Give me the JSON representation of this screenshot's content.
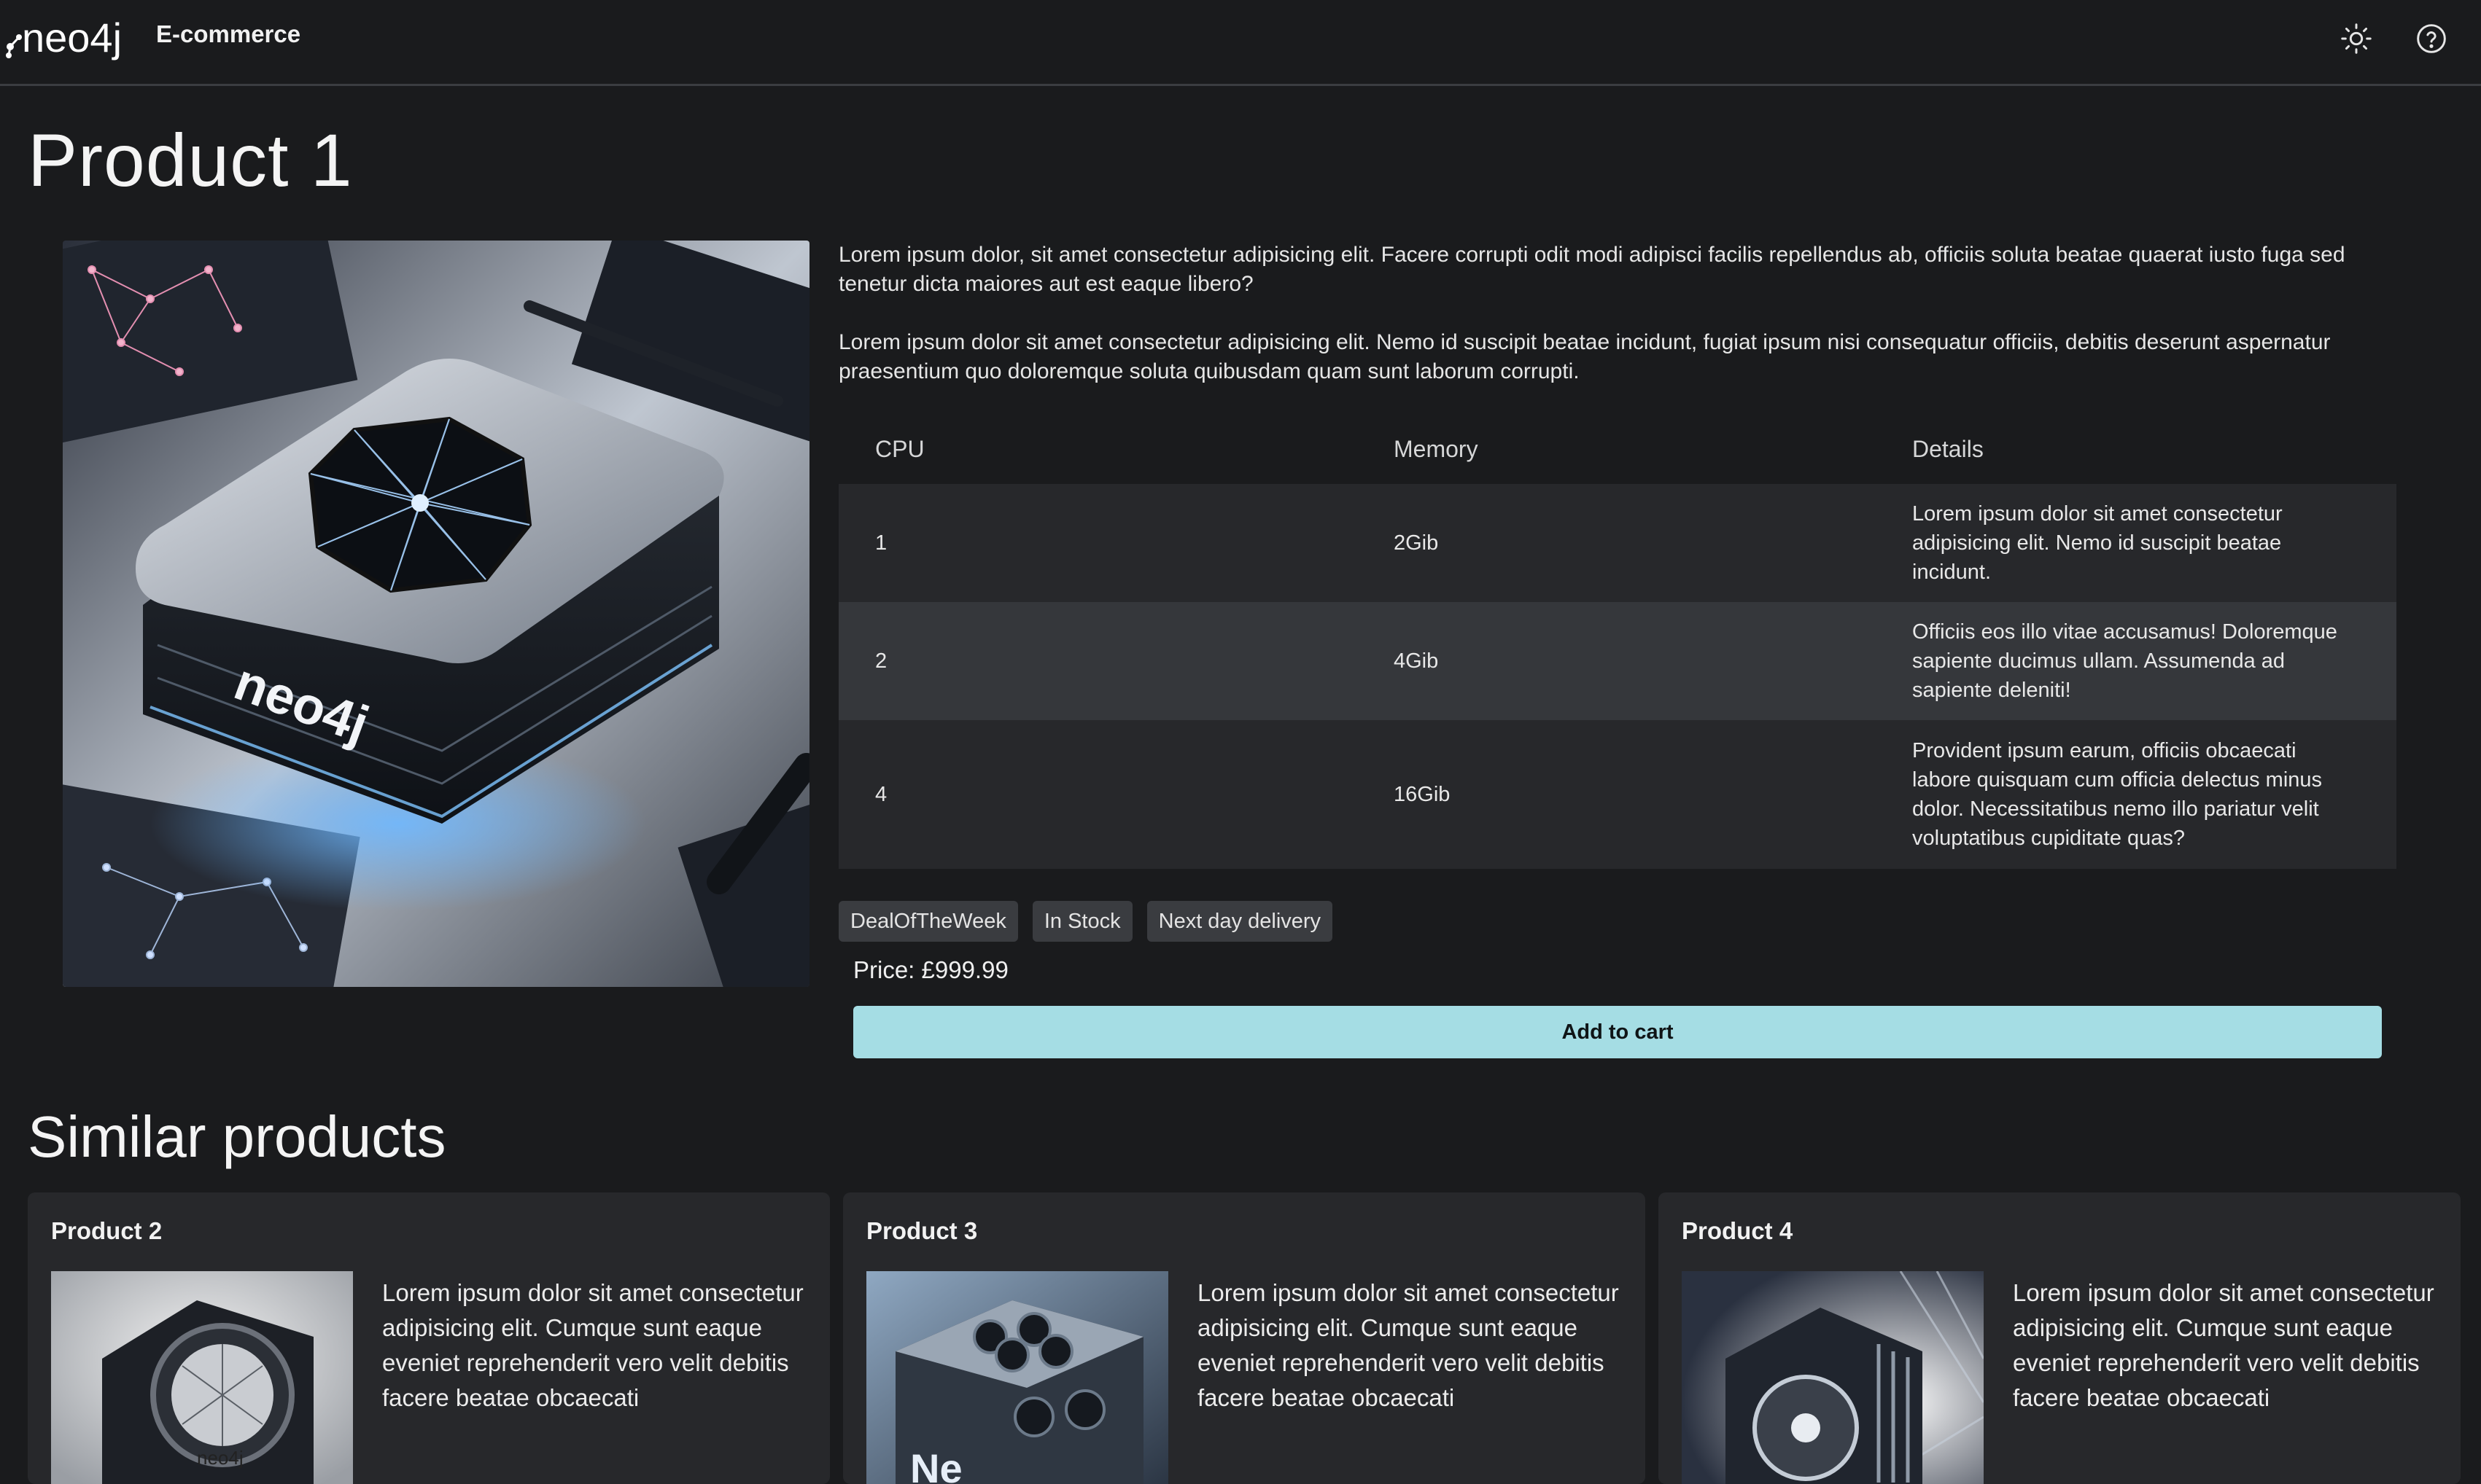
{
  "header": {
    "logo_text": "neo4j",
    "app_name": "E-commerce"
  },
  "product": {
    "title": "Product 1",
    "image_alt": "neo4j",
    "description": [
      "Lorem ipsum dolor, sit amet consectetur adipisicing elit. Facere corrupti odit modi adipisci facilis repellendus ab, officiis soluta beatae quaerat iusto fuga sed tenetur dicta maiores aut est eaque libero?",
      "Lorem ipsum dolor sit amet consectetur adipisicing elit. Nemo id suscipit beatae incidunt, fugiat ipsum nisi consequatur officiis, debitis deserunt aspernatur praesentium quo doloremque soluta quibusdam quam sunt laborum corrupti."
    ],
    "table": {
      "headers": [
        "CPU",
        "Memory",
        "Details"
      ],
      "rows": [
        [
          "1",
          "2Gib",
          "Lorem ipsum dolor sit amet consectetur adipisicing elit. Nemo id suscipit beatae incidunt."
        ],
        [
          "2",
          "4Gib",
          "Officiis eos illo vitae accusamus! Doloremque sapiente ducimus ullam. Assumenda ad sapiente deleniti!"
        ],
        [
          "4",
          "16Gib",
          "Provident ipsum earum, officiis obcaecati labore quisquam cum officia delectus minus dolor. Necessitatibus nemo illo pariatur velit voluptatibus cupiditate quas?"
        ]
      ]
    },
    "tags": [
      "DealOfTheWeek",
      "In Stock",
      "Next day delivery"
    ],
    "price": "Price: £999.99",
    "add_to_cart_label": "Add to cart"
  },
  "similar": {
    "title": "Similar products",
    "cards": [
      {
        "title": "Product 2",
        "text": "Lorem ipsum dolor sit amet consectetur adipisicing elit. Cumque sunt eaque eveniet reprehenderit vero velit debitis facere beatae obcaecati",
        "img_label": "neo4j"
      },
      {
        "title": "Product 3",
        "text": "Lorem ipsum dolor sit amet consectetur adipisicing elit. Cumque sunt eaque eveniet reprehenderit vero velit debitis facere beatae obcaecati",
        "img_label": "Ne"
      },
      {
        "title": "Product 4",
        "text": "Lorem ipsum dolor sit amet consectetur adipisicing elit. Cumque sunt eaque eveniet reprehenderit vero velit debitis facere beatae obcaecati",
        "img_label": ""
      }
    ]
  },
  "icons": {
    "theme_toggle": "sun-icon",
    "help": "help-circle-icon"
  },
  "colors": {
    "background": "#1a1b1d",
    "accent_button": "#a5dde4",
    "table_row_alt": "#35373b",
    "tag_bg": "#3a3c40"
  }
}
